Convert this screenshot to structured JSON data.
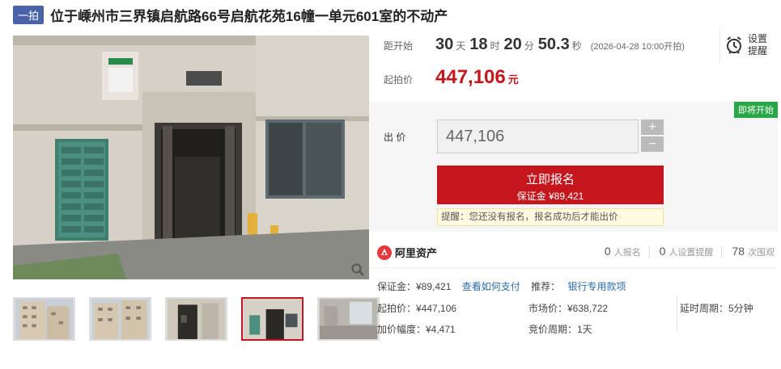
{
  "header": {
    "tag": "一拍",
    "title": "位于嵊州市三界镇启航路66号启航花苑16幢一单元601室的不动产"
  },
  "countdown": {
    "label": "距开始",
    "days": "30",
    "days_unit": "天",
    "hours": "18",
    "hours_unit": "时",
    "minutes": "20",
    "minutes_unit": "分",
    "seconds": "50.3",
    "seconds_unit": "秒",
    "start_time": "(2026-04-28 10:00开拍)"
  },
  "remind": {
    "line1": "设置",
    "line2": "提醒"
  },
  "start_price": {
    "label": "起拍价",
    "value": "447,106",
    "unit": "元"
  },
  "bid": {
    "status_badge": "即将开始",
    "label": "出 价",
    "input_value": "447,106",
    "plus": "+",
    "minus": "−",
    "apply_label": "立即报名",
    "deposit_text": "保证金 ¥89,421",
    "tip": "提醒：您还没有报名，报名成功后才能出价"
  },
  "stats": {
    "brand": "阿里资产",
    "registrations": "0",
    "registrations_label": "人报名",
    "reminders": "0",
    "reminders_label": "人设置提醒",
    "views": "78",
    "views_label": "次围观"
  },
  "details": {
    "deposit": "保证金：¥89,421",
    "how_to_pay": "查看如何支付",
    "recommend_label": "推荐：",
    "recommend_link": "银行专用款项",
    "start_price": "起拍价：¥447,106",
    "market_price": "市场价：¥638,722",
    "delay_period": "延时周期：5分钟",
    "increment": "加价幅度：¥4,471",
    "bid_period": "竞价周期：1天"
  },
  "colors": {
    "accent_red": "#c4161c",
    "tag_blue": "#4a63a8",
    "badge_green": "#28a745",
    "link_blue": "#2b6cb0"
  }
}
